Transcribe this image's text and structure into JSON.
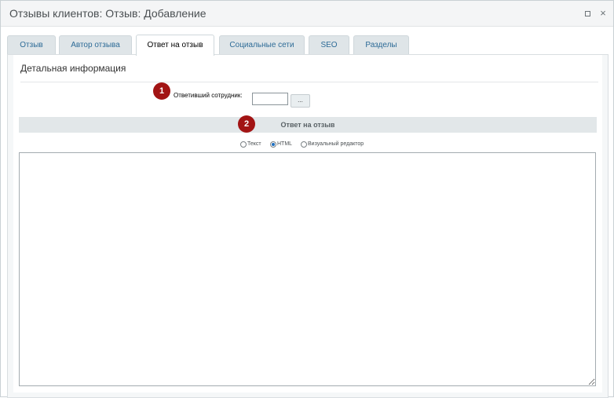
{
  "window": {
    "title": "Отзывы клиентов: Отзыв: Добавление",
    "maximize_icon": "maximize-icon",
    "close_label": "×"
  },
  "tabs": [
    {
      "label": "Отзыв",
      "active": false
    },
    {
      "label": "Автор отзыва",
      "active": false
    },
    {
      "label": "Ответ на отзыв",
      "active": true
    },
    {
      "label": "Социальные сети",
      "active": false
    },
    {
      "label": "SEO",
      "active": false
    },
    {
      "label": "Разделы",
      "active": false
    }
  ],
  "section": {
    "title": "Детальная информация",
    "markers": [
      "1",
      "2"
    ],
    "employee_field": {
      "label": "Ответивший сотрудник:",
      "value": "",
      "button_label": "..."
    },
    "answer_header": "Ответ на отзыв",
    "format_options": [
      {
        "label": "Текст",
        "checked": false
      },
      {
        "label": "HTML",
        "checked": true
      },
      {
        "label": "Визуальный редактор",
        "checked": false
      }
    ],
    "editor_value": ""
  },
  "colors": {
    "marker": "#a21414",
    "tab_text": "#2d6b97",
    "radio_checked": "#1f6fc1"
  }
}
